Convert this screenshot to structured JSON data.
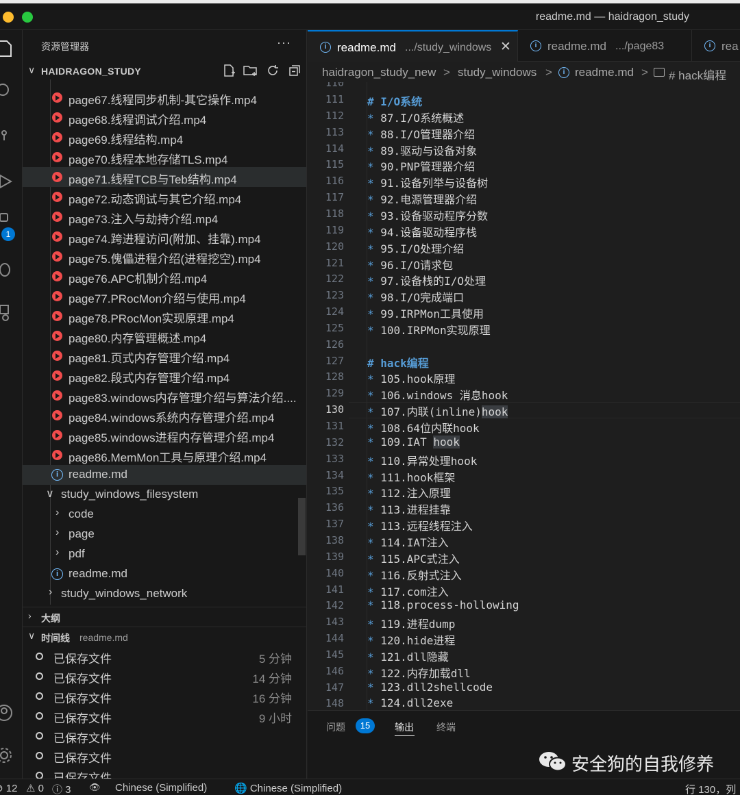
{
  "window": {
    "title": "readme.md — haidragon_study"
  },
  "activity": {
    "badge": "1"
  },
  "sidebar": {
    "header": "资源管理器",
    "more": "···",
    "explorer_title": "HAIDRAGON_STUDY",
    "tree": [
      {
        "type": "video",
        "label": "page67.线程同步机制-其它操作.mp4"
      },
      {
        "type": "video",
        "label": "page68.线程调试介绍.mp4"
      },
      {
        "type": "video",
        "label": "page69.线程结构.mp4"
      },
      {
        "type": "video",
        "label": "page70.线程本地存储TLS.mp4"
      },
      {
        "type": "video",
        "label": "page71.线程TCB与Teb结构.mp4"
      },
      {
        "type": "video",
        "label": "page72.动态调试与其它介绍.mp4"
      },
      {
        "type": "video",
        "label": "page73.注入与劫持介绍.mp4"
      },
      {
        "type": "video",
        "label": "page74.跨进程访问(附加、挂靠).mp4"
      },
      {
        "type": "video",
        "label": "page75.傀儡进程介绍(进程挖空).mp4"
      },
      {
        "type": "video",
        "label": "page76.APC机制介绍.mp4"
      },
      {
        "type": "video",
        "label": "page77.PRocMon介绍与使用.mp4"
      },
      {
        "type": "video",
        "label": "page78.PRocMon实现原理.mp4"
      },
      {
        "type": "video",
        "label": "page80.内存管理概述.mp4"
      },
      {
        "type": "video",
        "label": "page81.页式内存管理介绍.mp4"
      },
      {
        "type": "video",
        "label": "page82.段式内存管理介绍.mp4"
      },
      {
        "type": "video",
        "label": "page83.windows内存管理介绍与算法介绍...."
      },
      {
        "type": "video",
        "label": "page84.windows系统内存管理介绍.mp4"
      },
      {
        "type": "video",
        "label": "page85.windows进程内存管理介绍.mp4"
      },
      {
        "type": "video",
        "label": "page86.MemMon工具与原理介绍.mp4"
      },
      {
        "type": "info",
        "label": "readme.md"
      },
      {
        "type": "folder-open",
        "label": "study_windows_filesystem"
      },
      {
        "type": "folder",
        "label": "code"
      },
      {
        "type": "folder",
        "label": "page"
      },
      {
        "type": "folder",
        "label": "pdf"
      },
      {
        "type": "info",
        "label": "readme.md"
      },
      {
        "type": "folder-top",
        "label": "study_windows_network"
      }
    ],
    "outline_title": "大纲",
    "timeline_title": "时间线",
    "timeline_file": "readme.md",
    "timeline": [
      {
        "label": "已保存文件",
        "time": "5 分钟"
      },
      {
        "label": "已保存文件",
        "time": "14 分钟"
      },
      {
        "label": "已保存文件",
        "time": "16 分钟"
      },
      {
        "label": "已保存文件",
        "time": "9 小时"
      },
      {
        "label": "已保存文件",
        "time": ""
      },
      {
        "label": "已保存文件",
        "time": ""
      },
      {
        "label": "已保存文件",
        "time": ""
      }
    ]
  },
  "tabs": [
    {
      "name": "readme.md",
      "path": ".../study_windows",
      "close": "✕"
    },
    {
      "name": "readme.md",
      "path": ".../page83"
    },
    {
      "name": "rea"
    }
  ],
  "breadcrumb": {
    "root": "haidragon_study_new",
    "folder": "study_windows",
    "file": "readme.md",
    "symbol": "# hack编程",
    "sep": ">"
  },
  "code": {
    "top_partial": "110",
    "lines": [
      {
        "n": "111",
        "text": "# I/O系统",
        "heading": true
      },
      {
        "n": "112",
        "text": "87.I/O系统概述"
      },
      {
        "n": "113",
        "text": "88.I/O管理器介绍"
      },
      {
        "n": "114",
        "text": "89.驱动与设备对象"
      },
      {
        "n": "115",
        "text": "90.PNP管理器介绍"
      },
      {
        "n": "116",
        "text": "91.设备列举与设备树"
      },
      {
        "n": "117",
        "text": "92.电源管理器介绍"
      },
      {
        "n": "118",
        "text": "93.设备驱动程序分数"
      },
      {
        "n": "119",
        "text": "94.设备驱动程序栈"
      },
      {
        "n": "120",
        "text": "95.I/O处理介绍"
      },
      {
        "n": "121",
        "text": "96.I/O请求包"
      },
      {
        "n": "122",
        "text": "97.设备栈的I/O处理"
      },
      {
        "n": "123",
        "text": "98.I/O完成端口"
      },
      {
        "n": "124",
        "text": "99.IRPMon工具使用"
      },
      {
        "n": "125",
        "text": "100.IRPMon实现原理"
      },
      {
        "n": "126",
        "text": ""
      },
      {
        "n": "127",
        "text": "# hack编程",
        "heading": true
      },
      {
        "n": "128",
        "text": "105.hook原理"
      },
      {
        "n": "129",
        "text": "106.windows 消息hook"
      },
      {
        "n": "130",
        "text": "107.内联(inline)",
        "hl": "hook",
        "current": true
      },
      {
        "n": "131",
        "text": "108.64位内联hook"
      },
      {
        "n": "132",
        "text": "109.IAT ",
        "hl": "hook"
      },
      {
        "n": "133",
        "text": "110.异常处理hook"
      },
      {
        "n": "134",
        "text": "111.hook框架"
      },
      {
        "n": "135",
        "text": "112.注入原理"
      },
      {
        "n": "136",
        "text": "113.进程挂靠"
      },
      {
        "n": "137",
        "text": "113.远程线程注入"
      },
      {
        "n": "138",
        "text": "114.IAT注入"
      },
      {
        "n": "139",
        "text": "115.APC式注入"
      },
      {
        "n": "140",
        "text": "116.反射式注入"
      },
      {
        "n": "141",
        "text": "117.com注入"
      },
      {
        "n": "142",
        "text": "118.process-hollowing"
      },
      {
        "n": "143",
        "text": "119.进程dump"
      },
      {
        "n": "144",
        "text": "120.hide进程"
      },
      {
        "n": "145",
        "text": "121.dll隐藏"
      },
      {
        "n": "146",
        "text": "122.内存加载dll"
      },
      {
        "n": "147",
        "text": "123.dll2shellcode"
      },
      {
        "n": "148",
        "text": "124.dll2exe"
      }
    ]
  },
  "panel": {
    "problems": "问题",
    "problems_count": "15",
    "output": "输出",
    "terminal": "终端",
    "watermark": "安全狗的自我修养"
  },
  "status": {
    "errors": "⊘ 12",
    "warnings": "⚠ 0",
    "infos": "ⓘ 3",
    "watch": "👁",
    "lang1": "Chinese (Simplified)",
    "lang2": "🌐 Chinese (Simplified)",
    "position": "行 130，列"
  }
}
